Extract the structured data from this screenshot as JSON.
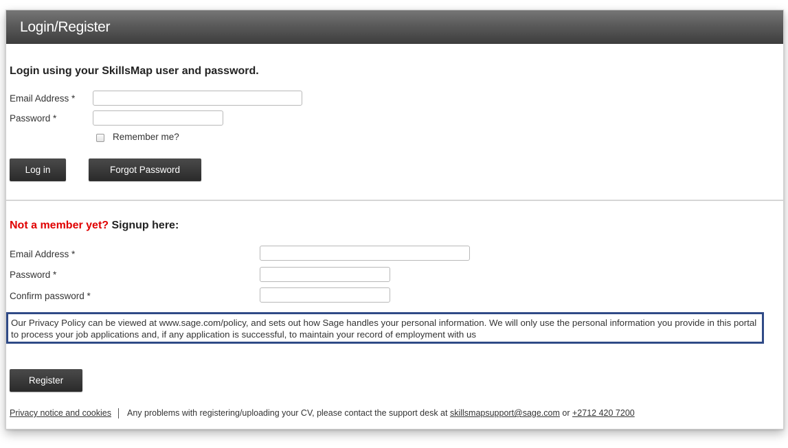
{
  "header": {
    "title": "Login/Register"
  },
  "login": {
    "heading": "Login using your SkillsMap user and password.",
    "email_label": "Email Address *",
    "email_value": "",
    "password_label": "Password *",
    "password_value": "",
    "remember_label": "Remember me?",
    "login_button": "Log in",
    "forgot_button": "Forgot Password"
  },
  "signup": {
    "heading_red": "Not a member yet?",
    "heading_rest": " Signup here:",
    "email_label": "Email Address *",
    "password_label": "Password *",
    "confirm_label": "Confirm password *",
    "register_button": "Register"
  },
  "privacy": {
    "text": "Our Privacy Policy can be viewed at www.sage.com/policy, and sets out how Sage handles your personal information. We will only use the personal information you provide in this portal to process your job applications and, if any application is successful, to maintain your record of employment with us"
  },
  "footer": {
    "privacy_link": "Privacy notice and cookies",
    "support_text": "Any problems with registering/uploading your CV, please contact the support desk at ",
    "email_link": "skillsmapsupport@sage.com",
    "or_text": " or ",
    "phone_link": "+2712 420 7200"
  },
  "colors": {
    "accent_red": "#e00000",
    "privacy_border": "#2f4a86",
    "button_bg": "#2a2a2a"
  }
}
